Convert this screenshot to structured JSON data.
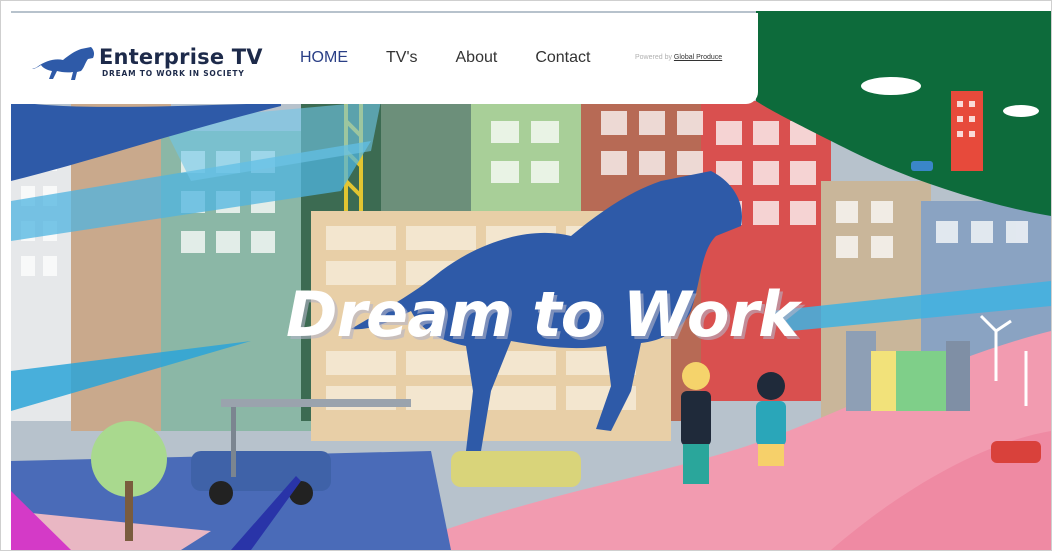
{
  "brand": {
    "title": "Enterprise TV",
    "tagline": "DREAM TO WORK IN SOCIETY",
    "logo_icon": "horse-logo-icon"
  },
  "nav": {
    "items": [
      {
        "label": "HOME",
        "active": true
      },
      {
        "label": "TV's",
        "active": false
      },
      {
        "label": "About",
        "active": false
      },
      {
        "label": "Contact",
        "active": false
      }
    ]
  },
  "powered": {
    "prefix": "Powered by",
    "link": "Global Produce"
  },
  "hero": {
    "title": "Dream to Work"
  },
  "colors": {
    "accent": "#2a3f86",
    "horse_blue": "#2e5aa8",
    "green_corner": "#0d6b3b",
    "pink_hill": "#f29bb0"
  }
}
